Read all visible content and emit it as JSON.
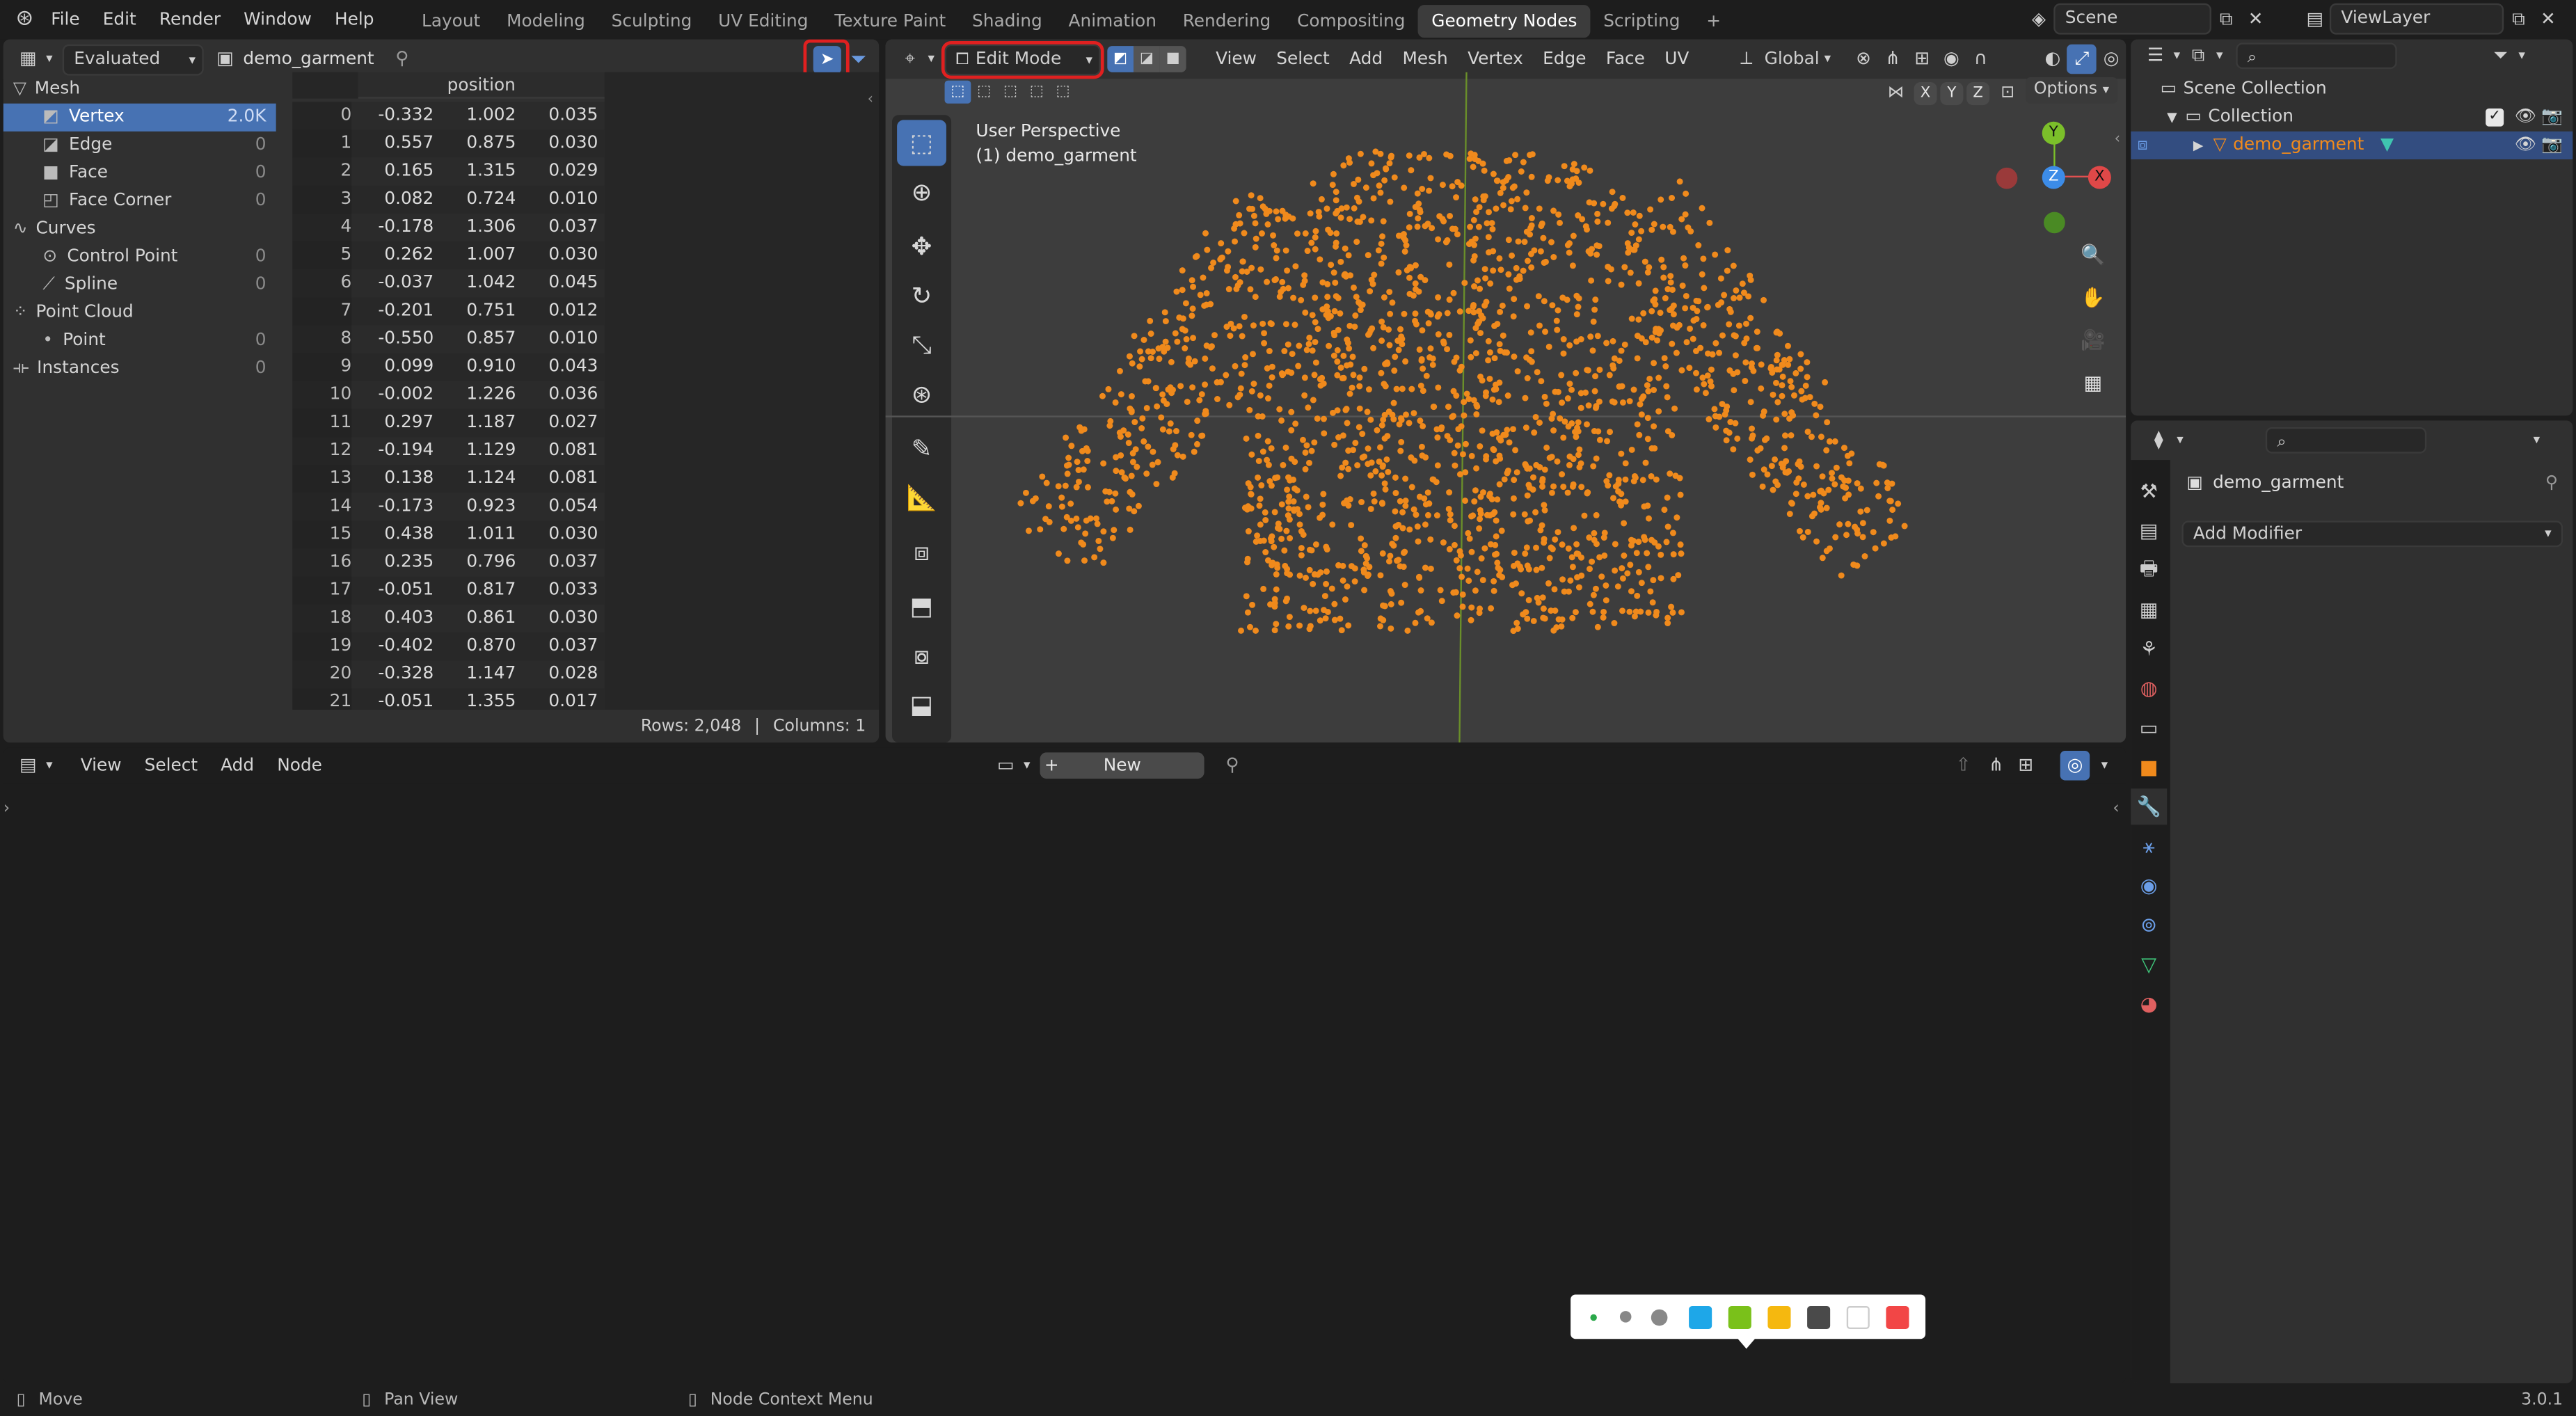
{
  "topbar": {
    "menus": [
      "File",
      "Edit",
      "Render",
      "Window",
      "Help"
    ],
    "workspaces": [
      "Layout",
      "Modeling",
      "Sculpting",
      "UV Editing",
      "Texture Paint",
      "Shading",
      "Animation",
      "Rendering",
      "Compositing",
      "Geometry Nodes",
      "Scripting"
    ],
    "active_workspace": "Geometry Nodes",
    "add_workspace": "+",
    "scene": "Scene",
    "view_layer": "ViewLayer"
  },
  "spreadsheet": {
    "mode": "Evaluated",
    "object": "demo_garment",
    "column_header": "position",
    "domains": [
      {
        "group": "Mesh",
        "items": [
          {
            "label": "Vertex",
            "count": "2.0K",
            "active": true
          },
          {
            "label": "Edge",
            "count": "0"
          },
          {
            "label": "Face",
            "count": "0"
          },
          {
            "label": "Face Corner",
            "count": "0"
          }
        ]
      },
      {
        "group": "Curves",
        "items": [
          {
            "label": "Control Point",
            "count": "0"
          },
          {
            "label": "Spline",
            "count": "0"
          }
        ]
      },
      {
        "group": "Point Cloud",
        "items": [
          {
            "label": "Point",
            "count": "0"
          }
        ]
      },
      {
        "group": "Instances",
        "items": [],
        "count": "0"
      }
    ],
    "rows": [
      [
        "0",
        "-0.332",
        "1.002",
        "0.035"
      ],
      [
        "1",
        "0.557",
        "0.875",
        "0.030"
      ],
      [
        "2",
        "0.165",
        "1.315",
        "0.029"
      ],
      [
        "3",
        "0.082",
        "0.724",
        "0.010"
      ],
      [
        "4",
        "-0.178",
        "1.306",
        "0.037"
      ],
      [
        "5",
        "0.262",
        "1.007",
        "0.030"
      ],
      [
        "6",
        "-0.037",
        "1.042",
        "0.045"
      ],
      [
        "7",
        "-0.201",
        "0.751",
        "0.012"
      ],
      [
        "8",
        "-0.550",
        "0.857",
        "0.010"
      ],
      [
        "9",
        "0.099",
        "0.910",
        "0.043"
      ],
      [
        "10",
        "-0.002",
        "1.226",
        "0.036"
      ],
      [
        "11",
        "0.297",
        "1.187",
        "0.027"
      ],
      [
        "12",
        "-0.194",
        "1.129",
        "0.081"
      ],
      [
        "13",
        "0.138",
        "1.124",
        "0.081"
      ],
      [
        "14",
        "-0.173",
        "0.923",
        "0.054"
      ],
      [
        "15",
        "0.438",
        "1.011",
        "0.030"
      ],
      [
        "16",
        "0.235",
        "0.796",
        "0.037"
      ],
      [
        "17",
        "-0.051",
        "0.817",
        "0.033"
      ],
      [
        "18",
        "0.403",
        "0.861",
        "0.030"
      ],
      [
        "19",
        "-0.402",
        "0.870",
        "0.037"
      ],
      [
        "20",
        "-0.328",
        "1.147",
        "0.028"
      ],
      [
        "21",
        "-0.051",
        "1.355",
        "0.017"
      ]
    ],
    "footer_rows": "Rows: 2,048",
    "footer_sep": "|",
    "footer_cols": "Columns: 1"
  },
  "viewport": {
    "mode": "Edit Mode",
    "menus": [
      "View",
      "Select",
      "Add",
      "Mesh",
      "Vertex",
      "Edge",
      "Face",
      "UV"
    ],
    "orientation": "Global",
    "options": "Options",
    "axes_toggle": [
      "X",
      "Y",
      "Z"
    ],
    "info_line1": "User Perspective",
    "info_line2": "(1) demo_garment",
    "gizmo": {
      "y": "Y",
      "z": "Z",
      "x": "X"
    },
    "point_color": "#f08a1c"
  },
  "node_editor": {
    "menus": [
      "View",
      "Select",
      "Add",
      "Node"
    ],
    "new_label": "New",
    "new_plus": "+",
    "palette_colors": [
      "#1ea7e8",
      "#7ac11a",
      "#f5b80f",
      "#4a4a4a",
      "#ffffff",
      "#f24646"
    ]
  },
  "outliner": {
    "scene_collection": "Scene Collection",
    "collection": "Collection",
    "object": "demo_garment"
  },
  "properties": {
    "object": "demo_garment",
    "add_modifier": "Add Modifier"
  },
  "statusbar": {
    "move": "Move",
    "pan": "Pan View",
    "context": "Node Context Menu",
    "version": "3.0.1"
  }
}
